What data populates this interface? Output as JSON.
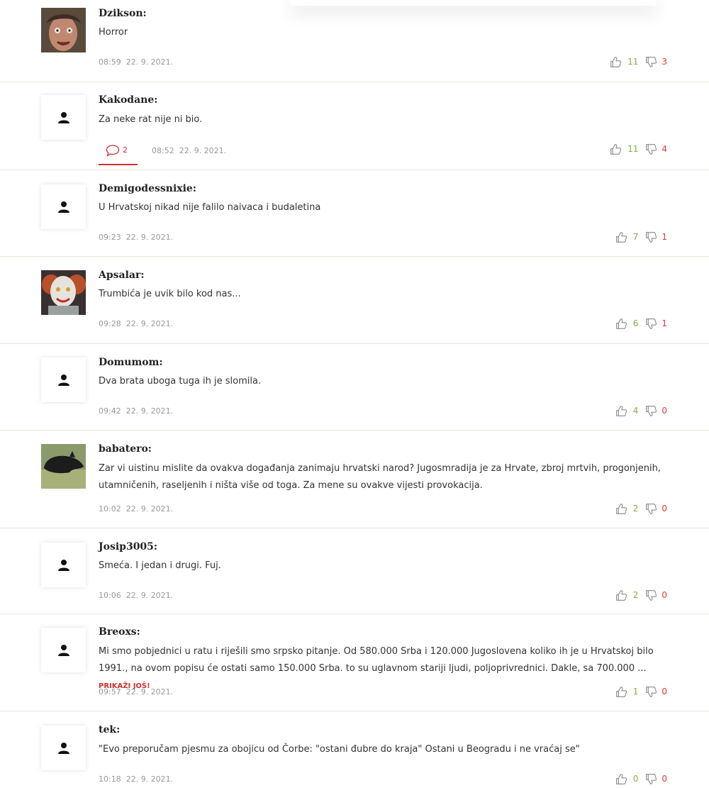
{
  "comments": [
    {
      "username": "Dzikson:",
      "text": "Horror",
      "time": "08:59",
      "date": "22. 9. 2021.",
      "likes": "11",
      "dislikes": "3",
      "avatar": "photo-face-icon"
    },
    {
      "username": "Kakodane:",
      "text": "Za neke rat nije ni bio.",
      "time": "08:52",
      "date": "22. 9. 2021.",
      "likes": "11",
      "dislikes": "4",
      "replies": "2",
      "avatar": "default-user-icon"
    },
    {
      "username": "Demigodessnixie:",
      "text": "U Hrvatskoj nikad nije falilo naivaca i budaletina",
      "time": "09:23",
      "date": "22. 9. 2021.",
      "likes": "7",
      "dislikes": "1",
      "avatar": "default-user-icon"
    },
    {
      "username": "Apsalar:",
      "text": "Trumbića je uvik bilo kod nas...",
      "time": "09:28",
      "date": "22. 9. 2021.",
      "likes": "6",
      "dislikes": "1",
      "avatar": "photo-clown-icon"
    },
    {
      "username": "Domumom:",
      "text": "Dva brata uboga tuga ih je slomila.",
      "time": "09:42",
      "date": "22. 9. 2021.",
      "likes": "4",
      "dislikes": "0",
      "avatar": "default-user-icon"
    },
    {
      "username": "babatero:",
      "text": "Zar vi uistinu mislite da ovakva događanja zanimaju hrvatski narod? Jugosmradija je za Hrvate, zbroj mrtvih, progonjenih, utamničenih, raseljenih i ništa više od toga. Za mene su ovakve vijesti provokacija.",
      "time": "10:02",
      "date": "22. 9. 2021.",
      "likes": "2",
      "dislikes": "0",
      "avatar": "photo-cat-icon"
    },
    {
      "username": "Josip3005:",
      "text": "Smeća. I jedan i drugi. Fuj.",
      "time": "10:06",
      "date": "22. 9. 2021.",
      "likes": "2",
      "dislikes": "0",
      "avatar": "default-user-icon"
    },
    {
      "username": "Breoxs:",
      "text": "Mi smo pobjednici u ratu i riješili smo srpsko pitanje. Od 580.000 Srba i 120.000 Jugoslovena koliko ih je u Hrvatskoj bilo 1991., na ovom popisu će ostati samo 150.000 Srba. to su uglavnom stariji ljudi, poljoprivrednici. Dakle, sa 700.000 ...",
      "more": "PRIKAŽI JOŠ!",
      "time": "09:57",
      "date": "22. 9. 2021.",
      "likes": "1",
      "dislikes": "0",
      "avatar": "default-user-icon"
    },
    {
      "username": "tek:",
      "text": "\"Evo preporučam pjesmu za obojicu od Čorbe: \"ostani đubre do kraja\" Ostani u Beogradu i ne vraćaj se\"",
      "time": "10:18",
      "date": "22. 9. 2021.",
      "likes": "0",
      "dislikes": "0",
      "avatar": "default-user-icon"
    }
  ],
  "colors": {
    "likes": "#7cb342",
    "dislikes": "#e53935",
    "accent": "#d32f2f"
  }
}
